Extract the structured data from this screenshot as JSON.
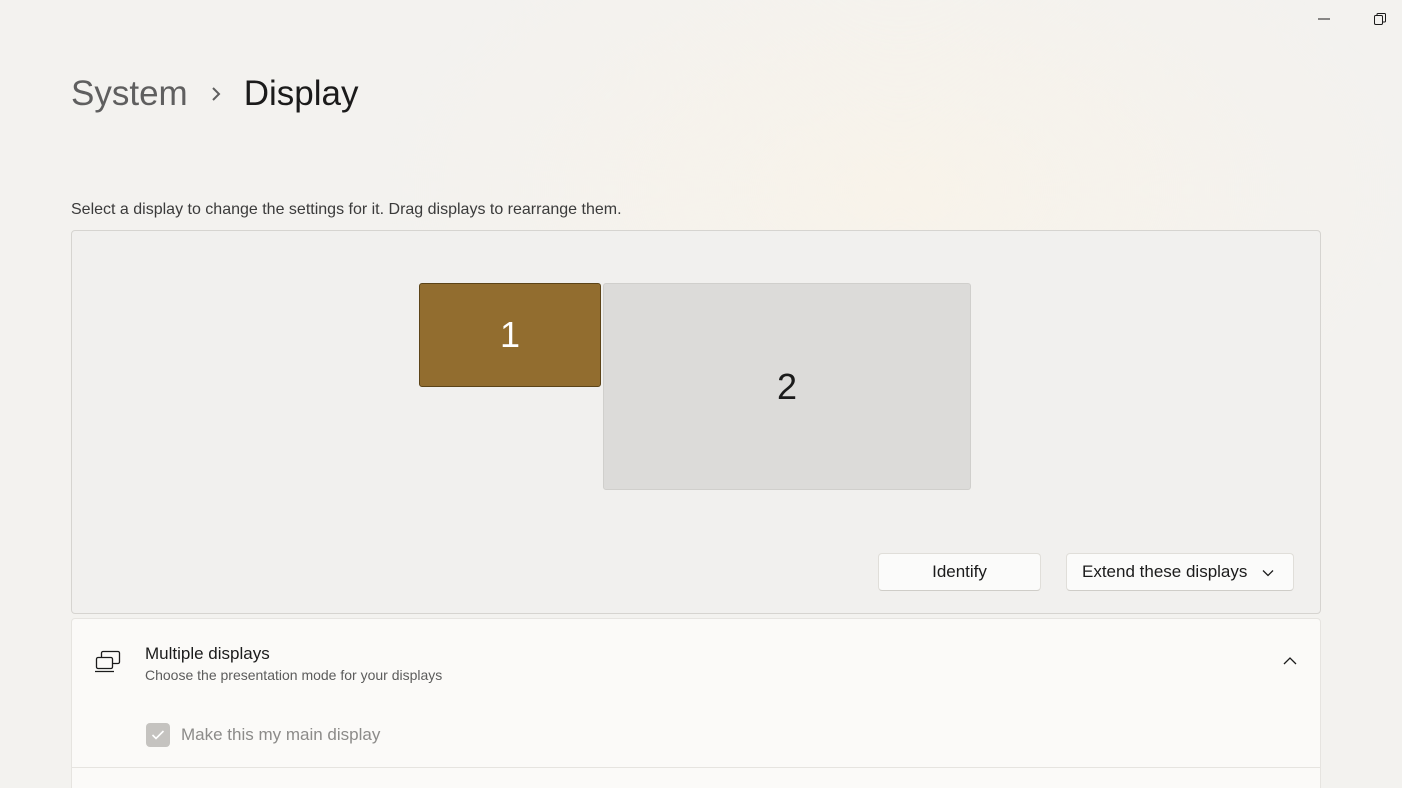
{
  "window": {
    "minimize_icon": "minimize-icon",
    "restore_icon": "restore-icon"
  },
  "breadcrumb": {
    "parent": "System",
    "separator_icon": "chevron-right-icon",
    "current": "Display"
  },
  "arrangement": {
    "hint": "Select a display to change the settings for it. Drag displays to rearrange them.",
    "monitors": [
      {
        "label": "1",
        "selected": true,
        "color": "#926d2f"
      },
      {
        "label": "2",
        "selected": false,
        "color": "#dcdbd9"
      }
    ],
    "identify_label": "Identify",
    "mode_value": "Extend these displays",
    "mode_icon": "chevron-down-icon"
  },
  "multiple_displays": {
    "icon": "multiple-displays-icon",
    "title": "Multiple displays",
    "subtitle": "Choose the presentation mode for your displays",
    "expanded": true,
    "collapse_icon": "chevron-up-icon",
    "main_display_label": "Make this my main display",
    "main_display_checked": true,
    "main_display_disabled": true
  },
  "colors": {
    "accent": "#926d2f",
    "background": "#f3f2ef",
    "card": "#fbfaf8"
  }
}
